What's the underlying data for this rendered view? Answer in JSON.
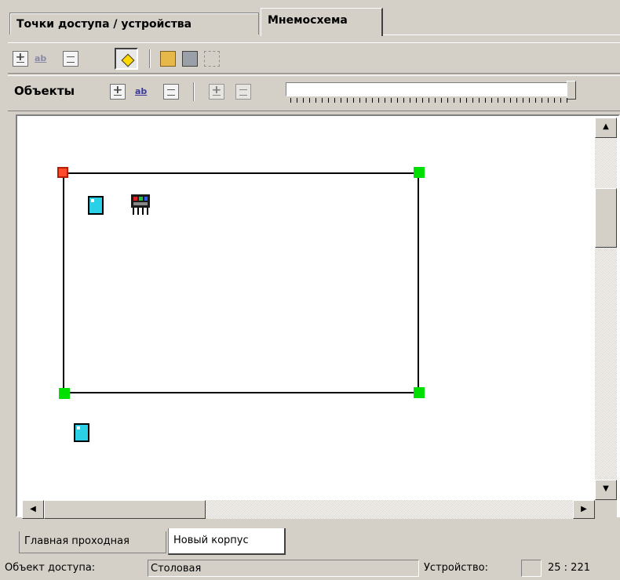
{
  "tabs": {
    "items": [
      "Точки доступа / устройства",
      "Мнемосхема"
    ],
    "active": "Мнемосхема"
  },
  "toolbar_objects": {
    "label": "Объекты"
  },
  "bottom_tabs": {
    "items": [
      "Главная проходная",
      "Новый корпус"
    ],
    "active": "Новый корпус"
  },
  "status": {
    "object_label": "Объект доступа:",
    "object_value": "Столовая",
    "device_label": "Устройство:",
    "device_value": "",
    "coords": "25 : 221"
  },
  "colors": {
    "handle": "#00e000",
    "handle_selected": "#ff4b2b",
    "device_icon": "#2ad0e6"
  }
}
